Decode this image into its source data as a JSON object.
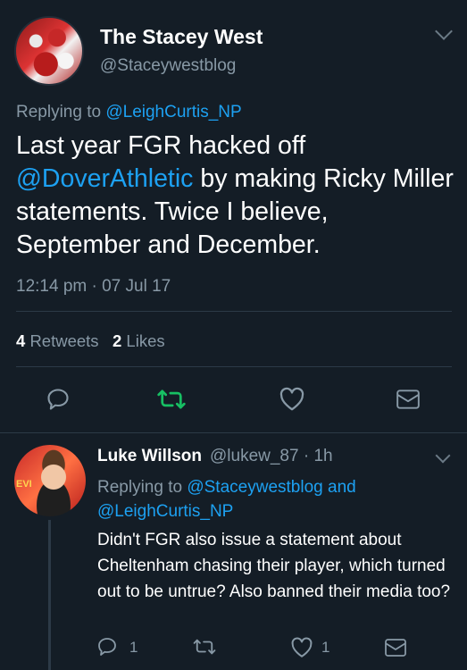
{
  "main_tweet": {
    "display_name": "The Stacey West",
    "handle": "@Staceywestblog",
    "replying_prefix": "Replying to",
    "replying_to": "@LeighCurtis_NP",
    "text_part1": "Last year FGR hacked off",
    "text_mention": "@DoverAthletic",
    "text_part2": " by making Ricky Miller statements. Twice I believe, September and December.",
    "timestamp": "12:14 pm · 07 Jul 17",
    "retweets_count": "4",
    "retweets_label": "Retweets",
    "likes_count": "2",
    "likes_label": "Likes",
    "actions": [
      "reply-icon",
      "retweet-icon",
      "like-icon",
      "message-icon"
    ]
  },
  "reply_tweet": {
    "display_name": "Luke Willson",
    "meta": "@lukew_87 · 1h",
    "avatar_text": "EVI",
    "replying_prefix": "Replying to",
    "replying_to_1": "@Staceywestblog",
    "replying_and": "and",
    "replying_to_2": "@LeighCurtis_NP",
    "text": "Didn't FGR also issue a statement about Cheltenham chasing their player, which turned out to be untrue? Also banned their media too?",
    "reply_count": "1",
    "like_count": "1"
  },
  "colors": {
    "background": "#141d26",
    "accent": "#1da1f2",
    "retweet_green": "#17bf63",
    "muted": "#8899a6"
  }
}
